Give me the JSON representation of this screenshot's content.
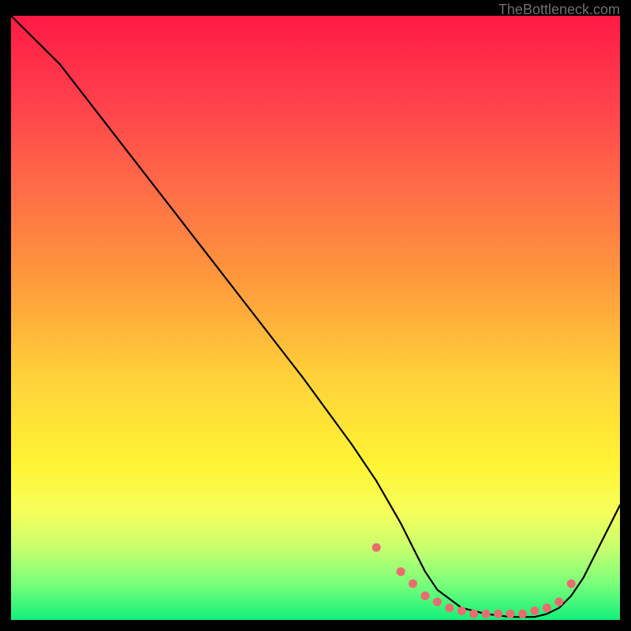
{
  "watermark": "TheBottleneck.com",
  "chart_data": {
    "type": "line",
    "title": "",
    "xlabel": "",
    "ylabel": "",
    "xlim": [
      0,
      100
    ],
    "ylim": [
      0,
      100
    ],
    "series": [
      {
        "name": "curve",
        "x": [
          0,
          8,
          18,
          28,
          38,
          48,
          56,
          60,
          64,
          66,
          68,
          70,
          74,
          78,
          82,
          86,
          88,
          90,
          92,
          94,
          96,
          98,
          100
        ],
        "y": [
          100,
          92,
          79,
          66,
          53,
          40,
          29,
          23,
          16,
          12,
          8,
          5,
          2,
          1,
          0.5,
          0.5,
          1,
          2,
          4,
          7,
          11,
          15,
          19
        ]
      },
      {
        "name": "markers",
        "x": [
          60,
          64,
          66,
          68,
          70,
          72,
          74,
          76,
          78,
          80,
          82,
          84,
          86,
          88,
          90,
          92
        ],
        "y": [
          12,
          8,
          6,
          4,
          3,
          2,
          1.5,
          1,
          1,
          1,
          1,
          1,
          1.5,
          2,
          3,
          6
        ]
      }
    ]
  }
}
